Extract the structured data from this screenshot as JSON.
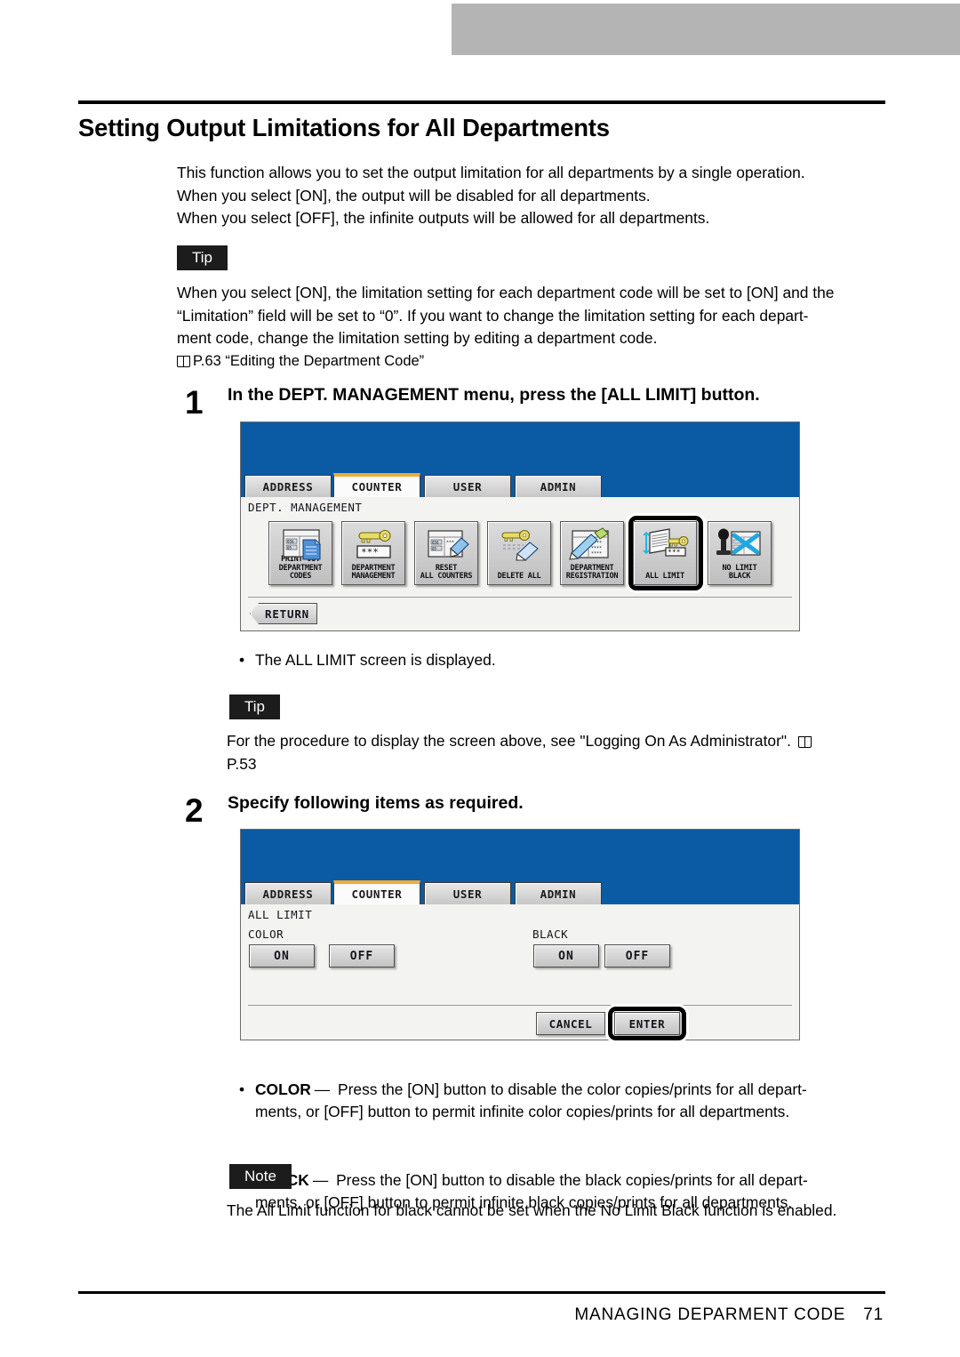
{
  "page": {
    "title": "Setting Output Limitations for All Departments",
    "intro": [
      "This function allows you to set the output limitation for all departments by a single operation.",
      "When you select [ON], the output will be disabled for all departments.",
      "When you select [OFF], the infinite outputs will be allowed for all departments."
    ],
    "footer_title": "MANAGING DEPARMENT CODE",
    "footer_page": "71"
  },
  "tip1": {
    "label": "Tip",
    "lines": [
      "When you select [ON], the limitation setting for each department code will be set to [ON] and the",
      "“Limitation” field will be set to “0”.  If you want to change the limitation setting for each depart-",
      "ment code, change the limitation setting by editing a department code."
    ],
    "reference": "P.63 “Editing the Department Code”"
  },
  "step1": {
    "number": "1",
    "text": "In the DEPT. MANAGEMENT menu, press the [ALL LIMIT] button.",
    "result_bullet": "•",
    "result": "The ALL LIMIT screen is displayed."
  },
  "tip2": {
    "label": "Tip",
    "lines": [
      "For the procedure to display the screen above, see \"Logging On As Administrator\".",
      "P.53"
    ]
  },
  "step2": {
    "number": "2",
    "text": "Specify following items as required."
  },
  "screen1": {
    "tabs": [
      {
        "label": "ADDRESS",
        "active": false
      },
      {
        "label": "COUNTER",
        "active": true
      },
      {
        "label": "USER",
        "active": false
      },
      {
        "label": "ADMIN",
        "active": false
      }
    ],
    "breadcrumb": "DEPT. MANAGEMENT",
    "buttons": [
      {
        "caption1": "PRINT OUT",
        "caption2": "DEPARTMENT CODES",
        "icon": "print-out-department-codes-icon",
        "selected": false
      },
      {
        "caption1": "DEPARTMENT",
        "caption2": "MANAGEMENT",
        "icon": "department-management-icon",
        "selected": false
      },
      {
        "caption1": "RESET",
        "caption2": "ALL COUNTERS",
        "icon": "reset-all-counters-icon",
        "selected": false
      },
      {
        "caption1": "DELETE ALL",
        "caption2": "",
        "icon": "delete-all-icon",
        "selected": false
      },
      {
        "caption1": "DEPARTMENT",
        "caption2": "REGISTRATION",
        "icon": "department-registration-icon",
        "selected": false
      },
      {
        "caption1": "ALL LIMIT",
        "caption2": "",
        "icon": "all-limit-icon",
        "selected": true
      },
      {
        "caption1": "NO LIMIT",
        "caption2": "BLACK",
        "icon": "no-limit-black-icon",
        "selected": false
      }
    ],
    "return_label": "RETURN"
  },
  "screen2": {
    "tabs": [
      {
        "label": "ADDRESS",
        "active": false
      },
      {
        "label": "COUNTER",
        "active": true
      },
      {
        "label": "USER",
        "active": false
      },
      {
        "label": "ADMIN",
        "active": false
      }
    ],
    "breadcrumb": "ALL LIMIT",
    "groups": [
      {
        "title": "COLOR",
        "on_label": "ON",
        "off_label": "OFF"
      },
      {
        "title": "BLACK",
        "on_label": "ON",
        "off_label": "OFF"
      }
    ],
    "cancel_label": "CANCEL",
    "enter_label": "ENTER"
  },
  "options": {
    "bullet": "•",
    "items": [
      {
        "term": "COLOR",
        "dash": "—",
        "line1": " Press the [ON] button to disable the color copies/prints for all depart-",
        "line2": "ments, or [OFF] button to permit infinite color copies/prints for all departments."
      },
      {
        "term": "BLACK",
        "dash": "—",
        "line1": " Press the [ON] button to disable the black copies/prints for all depart-",
        "line2": "ments, or [OFF] button to permit infinite black copies/prints for all departments."
      }
    ]
  },
  "note": {
    "label": "Note",
    "text": "The All Limit function for black cannot be set when the No Limit Black function is enabled."
  },
  "colors": {
    "screen_header_blue": "#0a5ba3",
    "active_tab_accent": "#f0ab3a",
    "tag_black": "#1c1c1c",
    "top_bar_gray": "#b4b4b4"
  }
}
